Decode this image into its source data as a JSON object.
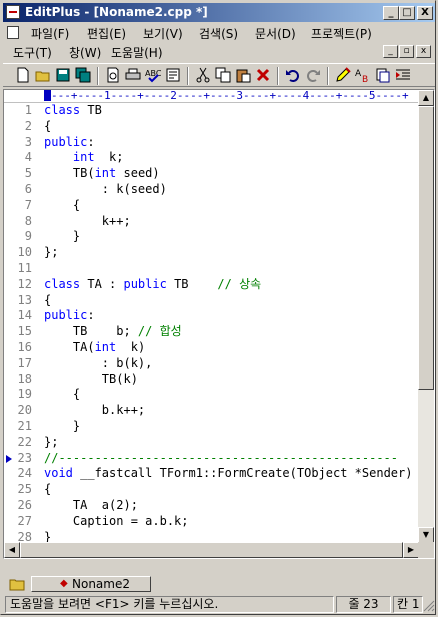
{
  "window": {
    "title": "EditPlus - [Noname2.cpp *]",
    "title_buttons": [
      "_",
      "□",
      "X"
    ]
  },
  "menu": [
    {
      "label": "파일(F)"
    },
    {
      "label": "편집(E)"
    },
    {
      "label": "보기(V)"
    },
    {
      "label": "검색(S)"
    },
    {
      "label": "문서(D)"
    },
    {
      "label": "프로젝트(P)"
    },
    {
      "label": "도구(T)"
    },
    {
      "label": "창(W)"
    },
    {
      "label": "도움말(H)"
    }
  ],
  "mdi_buttons": [
    "_",
    "▫",
    "x"
  ],
  "toolbar": [
    "new-file-icon",
    "open-folder-icon",
    "save-icon",
    "save-all-icon",
    "print-preview-icon",
    "print-icon",
    "spell-check-icon",
    "browser-icon",
    "cut-icon",
    "copy-icon",
    "paste-icon",
    "delete-icon",
    "undo-icon",
    "redo-icon",
    "highlight-icon",
    "replace-icon",
    "clipboard-icon",
    "indent-icon"
  ],
  "ruler": "---+----1----+----2----+----3----+----4----+----5----+",
  "code_lines": [
    {
      "n": "1",
      "parts": [
        {
          "t": "class",
          "c": "kw"
        },
        {
          "t": " TB",
          "c": ""
        }
      ]
    },
    {
      "n": "2",
      "parts": [
        {
          "t": "{",
          "c": ""
        }
      ]
    },
    {
      "n": "3",
      "parts": [
        {
          "t": "public",
          "c": "kw"
        },
        {
          "t": ":",
          "c": ""
        }
      ]
    },
    {
      "n": "4",
      "parts": [
        {
          "t": "    ",
          "c": ""
        },
        {
          "t": "int",
          "c": "kw"
        },
        {
          "t": "  k;",
          "c": ""
        }
      ]
    },
    {
      "n": "5",
      "parts": [
        {
          "t": "    TB(",
          "c": ""
        },
        {
          "t": "int",
          "c": "kw"
        },
        {
          "t": " seed)",
          "c": ""
        }
      ]
    },
    {
      "n": "6",
      "parts": [
        {
          "t": "        : k(seed)",
          "c": ""
        }
      ]
    },
    {
      "n": "7",
      "parts": [
        {
          "t": "    {",
          "c": ""
        }
      ]
    },
    {
      "n": "8",
      "parts": [
        {
          "t": "        k++;",
          "c": ""
        }
      ]
    },
    {
      "n": "9",
      "parts": [
        {
          "t": "    }",
          "c": ""
        }
      ]
    },
    {
      "n": "10",
      "parts": [
        {
          "t": "};",
          "c": ""
        }
      ]
    },
    {
      "n": "11",
      "parts": []
    },
    {
      "n": "12",
      "parts": [
        {
          "t": "class",
          "c": "kw"
        },
        {
          "t": " TA : ",
          "c": ""
        },
        {
          "t": "public",
          "c": "kw"
        },
        {
          "t": " TB    ",
          "c": ""
        },
        {
          "t": "// 상속",
          "c": "cm"
        }
      ]
    },
    {
      "n": "13",
      "parts": [
        {
          "t": "{",
          "c": ""
        }
      ]
    },
    {
      "n": "14",
      "parts": [
        {
          "t": "public",
          "c": "kw"
        },
        {
          "t": ":",
          "c": ""
        }
      ]
    },
    {
      "n": "15",
      "parts": [
        {
          "t": "    TB    b; ",
          "c": ""
        },
        {
          "t": "// 합성",
          "c": "cm"
        }
      ]
    },
    {
      "n": "16",
      "parts": [
        {
          "t": "    TA(",
          "c": ""
        },
        {
          "t": "int",
          "c": "kw"
        },
        {
          "t": "  k)",
          "c": ""
        }
      ]
    },
    {
      "n": "17",
      "parts": [
        {
          "t": "        : b(k),",
          "c": ""
        }
      ]
    },
    {
      "n": "18",
      "parts": [
        {
          "t": "        TB(k)",
          "c": ""
        }
      ]
    },
    {
      "n": "19",
      "parts": [
        {
          "t": "    {",
          "c": ""
        }
      ]
    },
    {
      "n": "20",
      "parts": [
        {
          "t": "        b.k++;",
          "c": ""
        }
      ]
    },
    {
      "n": "21",
      "parts": [
        {
          "t": "    }",
          "c": ""
        }
      ]
    },
    {
      "n": "22",
      "parts": [
        {
          "t": "};",
          "c": ""
        }
      ]
    },
    {
      "n": "23",
      "parts": [
        {
          "t": "//-----------------------------------------------",
          "c": "cm"
        }
      ],
      "marker": true
    },
    {
      "n": "24",
      "parts": [
        {
          "t": "void",
          "c": "kw"
        },
        {
          "t": " __fastcall TForm1::FormCreate(TObject *Sender)",
          "c": ""
        }
      ]
    },
    {
      "n": "25",
      "parts": [
        {
          "t": "{",
          "c": ""
        }
      ]
    },
    {
      "n": "26",
      "parts": [
        {
          "t": "    TA  a(2);",
          "c": ""
        }
      ]
    },
    {
      "n": "27",
      "parts": [
        {
          "t": "    Caption = a.b.k;",
          "c": ""
        }
      ]
    },
    {
      "n": "28",
      "parts": [
        {
          "t": "}",
          "c": ""
        }
      ]
    }
  ],
  "tab": {
    "label": "Noname2"
  },
  "status": {
    "hint": "도움말을 보려면 <F1> 키를 누르십시오.",
    "line": "줄 23",
    "col": "칸 1"
  }
}
